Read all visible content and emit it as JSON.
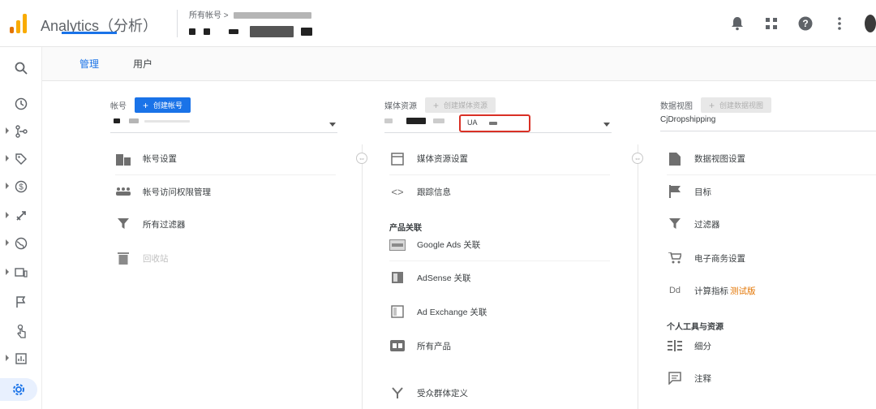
{
  "app": {
    "title": "Analytics（分析）",
    "breadcrumb": "所有帐号 >",
    "logo_colors": [
      "#f9ab00",
      "#e37400",
      "#e37400"
    ]
  },
  "topbar_icons": [
    "bell-icon",
    "apps-grid-icon",
    "help-icon",
    "more-vert-icon",
    "avatar"
  ],
  "rail": [
    "search-icon",
    "clock-icon",
    "customization-icon",
    "tag-icon",
    "dollar-icon",
    "acquisition-icon",
    "globe-icon",
    "devices-icon",
    "flag-icon",
    "touch-icon",
    "report-icon",
    "gear-icon"
  ],
  "tabs": {
    "admin": "管理",
    "user": "用户"
  },
  "account": {
    "header": "帐号",
    "create": "创建帐号",
    "items": [
      {
        "label": "帐号设置"
      },
      {
        "label": "帐号访问权限管理"
      },
      {
        "label": "所有过滤器"
      },
      {
        "label": "回收站"
      }
    ]
  },
  "property": {
    "header": "媒体资源",
    "create": "创建媒体资源",
    "ua_prefix": "UA",
    "items": [
      {
        "label": "媒体资源设置"
      },
      {
        "label": "跟踪信息"
      }
    ],
    "section": "产品关联",
    "product_items": [
      {
        "label": "Google Ads 关联"
      },
      {
        "label": "AdSense 关联"
      },
      {
        "label": "Ad Exchange 关联"
      },
      {
        "label": "所有产品"
      },
      {
        "label": "受众群体定义"
      }
    ]
  },
  "view": {
    "header": "数据视图",
    "create": "创建数据视图",
    "selected": "CjDropshipping",
    "items": [
      {
        "label": "数据视图设置"
      },
      {
        "label": "目标"
      },
      {
        "label": "过滤器"
      },
      {
        "label": "电子商务设置"
      },
      {
        "label": "计算指标",
        "badge": "测试版"
      }
    ],
    "section": "个人工具与资源",
    "tool_items": [
      {
        "label": "细分"
      },
      {
        "label": "注释"
      }
    ]
  },
  "colors": {
    "accent": "#1a73e8",
    "highlight_box": "#d93025",
    "beta": "#e37400"
  }
}
